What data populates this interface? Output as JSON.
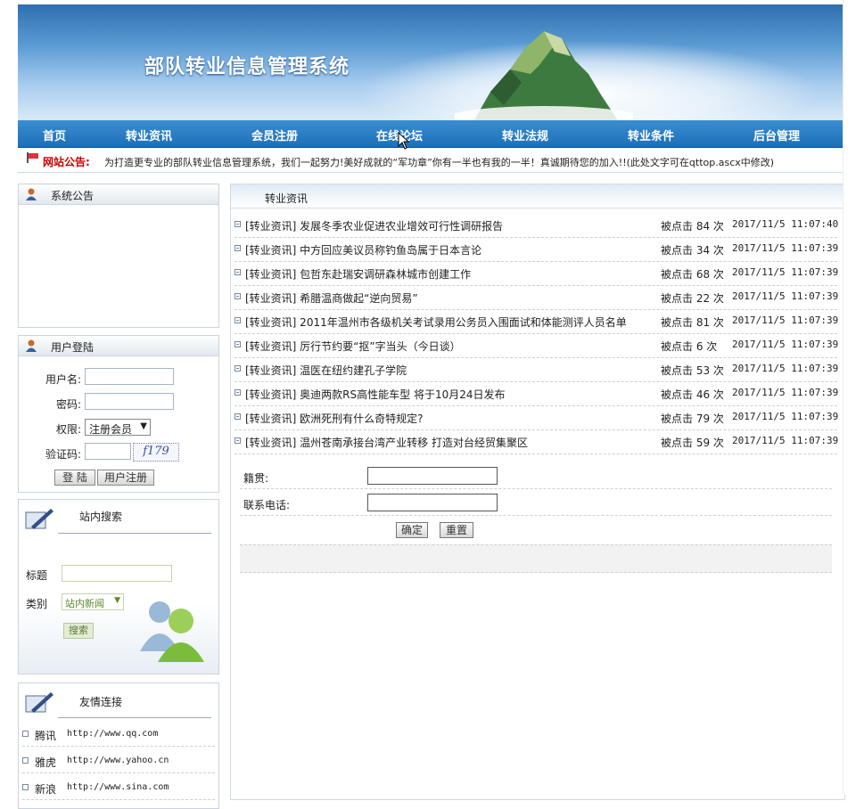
{
  "banner": {
    "title": "部队转业信息管理系统"
  },
  "nav": [
    "首页",
    "转业资讯",
    "会员注册",
    "在线论坛",
    "转业法规",
    "转业条件",
    "后台管理"
  ],
  "notice": {
    "label": "网站公告:",
    "text": "为打造更专业的部队转业信息管理系统，我们一起努力!美好成就的“军功章”你有一半也有我的一半！真诚期待您的加入!!(此处文字可在qttop.ascx中修改)"
  },
  "announcement": {
    "title": "系统公告"
  },
  "login": {
    "title": "用户登陆",
    "username_label": "用户名:",
    "password_label": "密码:",
    "role_label": "权限:",
    "role_value": "注册会员",
    "captcha_label": "验证码:",
    "captcha_text": "f179",
    "login_btn": "登 陆",
    "register_btn": "用户注册"
  },
  "search": {
    "title": "站内搜索",
    "title_label": "标题",
    "type_label": "类别",
    "type_value": "站内新闻",
    "search_btn": "搜索"
  },
  "links": {
    "title": "友情连接",
    "items": [
      {
        "name": "腾讯",
        "url": "http://www.qq.com"
      },
      {
        "name": "雅虎",
        "url": "http://www.yahoo.cn"
      },
      {
        "name": "新浪",
        "url": "http://www.sina.com"
      }
    ]
  },
  "news": {
    "title": "转业资讯",
    "items": [
      {
        "title": "[转业资讯] 发展冬季农业促进农业增效可行性调研报告",
        "clicks": "被点击 84 次",
        "date": "2017/11/5 11:07:40"
      },
      {
        "title": "[转业资讯] 中方回应美议员称钓鱼岛属于日本言论",
        "clicks": "被点击 34 次",
        "date": "2017/11/5 11:07:39"
      },
      {
        "title": "[转业资讯] 包哲东赴瑞安调研森林城市创建工作",
        "clicks": "被点击 68 次",
        "date": "2017/11/5 11:07:39"
      },
      {
        "title": "[转业资讯] 希腊温商做起“逆向贸易”",
        "clicks": "被点击 22 次",
        "date": "2017/11/5 11:07:39"
      },
      {
        "title": "[转业资讯] 2011年温州市各级机关考试录用公务员入围面试和体能测评人员名单",
        "clicks": "被点击 81 次",
        "date": "2017/11/5 11:07:39"
      },
      {
        "title": "[转业资讯] 厉行节约要“抠”字当头（今日谈）",
        "clicks": "被点击 6 次",
        "date": "2017/11/5 11:07:39"
      },
      {
        "title": "[转业资讯] 温医在纽约建孔子学院",
        "clicks": "被点击 53 次",
        "date": "2017/11/5 11:07:39"
      },
      {
        "title": "[转业资讯] 奥迪两款RS高性能车型 将于10月24日发布",
        "clicks": "被点击 46 次",
        "date": "2017/11/5 11:07:39"
      },
      {
        "title": "[转业资讯] 欧洲死刑有什么奇特规定?",
        "clicks": "被点击 79 次",
        "date": "2017/11/5 11:07:39"
      },
      {
        "title": "[转业资讯] 温州苍南承接台湾产业转移 打造对台经贸集聚区",
        "clicks": "被点击 59 次",
        "date": "2017/11/5 11:07:39"
      }
    ]
  },
  "form": {
    "native_label": "籍贯:",
    "phone_label": "联系电话:",
    "ok_btn": "确定",
    "reset_btn": "重置"
  }
}
